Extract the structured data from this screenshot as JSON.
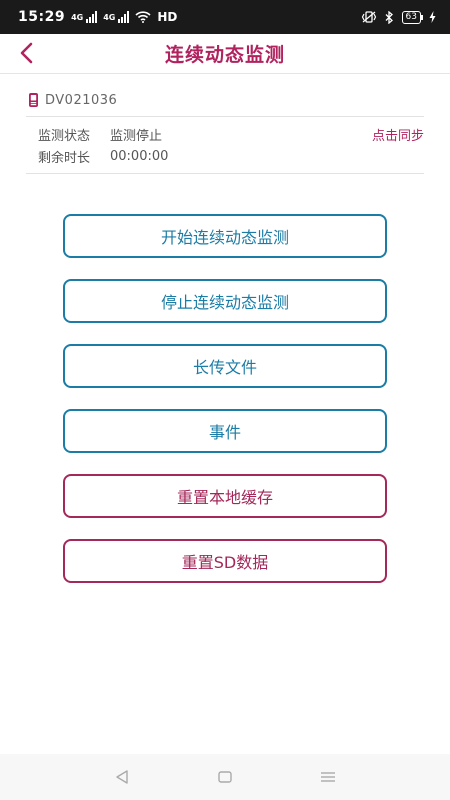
{
  "status_bar": {
    "time": "15:29",
    "network": "HD",
    "battery": "63"
  },
  "header": {
    "title": "连续动态监测"
  },
  "device": {
    "id": "DV021036"
  },
  "info": {
    "status_label": "监测状态",
    "status_value": "监测停止",
    "remaining_label": "剩余时长",
    "remaining_value": "00:00:00",
    "sync_label": "点击同步"
  },
  "actions": {
    "start": "开始连续动态监测",
    "stop": "停止连续动态监测",
    "upload": "长传文件",
    "events": "事件",
    "reset_cache": "重置本地缓存",
    "reset_sd": "重置SD数据"
  },
  "colors": {
    "accent_magenta": "#b0235f",
    "accent_blue": "#1b7ca6"
  }
}
